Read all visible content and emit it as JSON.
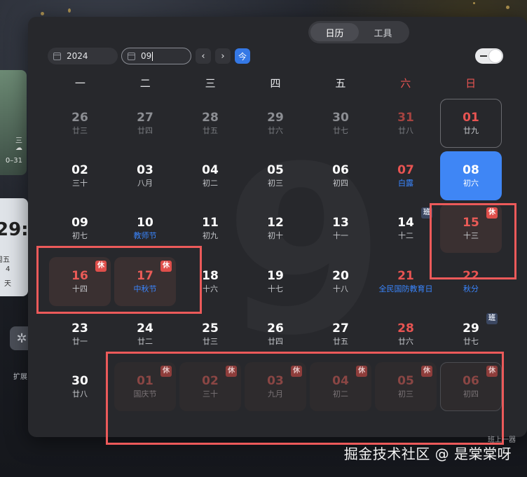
{
  "tabs": [
    {
      "label": "日历",
      "active": true
    },
    {
      "label": "工具",
      "active": false
    }
  ],
  "controls": {
    "year_value": "2024",
    "month_value": "09",
    "prev_icon": "‹",
    "next_icon": "›",
    "today_label": "今",
    "toggle_state": "on"
  },
  "weekdays": [
    "一",
    "二",
    "三",
    "四",
    "五",
    "六",
    "日"
  ],
  "days": [
    {
      "day": "26",
      "lunar": "廿三",
      "other": true
    },
    {
      "day": "27",
      "lunar": "廿四",
      "other": true
    },
    {
      "day": "28",
      "lunar": "廿五",
      "other": true
    },
    {
      "day": "29",
      "lunar": "廿六",
      "other": true
    },
    {
      "day": "30",
      "lunar": "廿七",
      "other": true
    },
    {
      "day": "31",
      "lunar": "廿八",
      "other": true,
      "weekend": true
    },
    {
      "day": "01",
      "lunar": "廿九",
      "weekend": true,
      "outlined": true
    },
    {
      "day": "02",
      "lunar": "三十"
    },
    {
      "day": "03",
      "lunar": "八月"
    },
    {
      "day": "04",
      "lunar": "初二"
    },
    {
      "day": "05",
      "lunar": "初三"
    },
    {
      "day": "06",
      "lunar": "初四"
    },
    {
      "day": "07",
      "lunar": "白露",
      "weekend": true,
      "festival": true
    },
    {
      "day": "08",
      "lunar": "初六",
      "selected": true
    },
    {
      "day": "09",
      "lunar": "初七"
    },
    {
      "day": "10",
      "lunar": "教师节",
      "festival": true
    },
    {
      "day": "11",
      "lunar": "初九"
    },
    {
      "day": "12",
      "lunar": "初十"
    },
    {
      "day": "13",
      "lunar": "十一"
    },
    {
      "day": "14",
      "lunar": "十二",
      "badge": "班",
      "badge_type": "work"
    },
    {
      "day": "15",
      "lunar": "十三",
      "holiday": true,
      "badge": "休",
      "badge_type": "rest"
    },
    {
      "day": "16",
      "lunar": "十四",
      "holiday": true,
      "badge": "休",
      "badge_type": "rest"
    },
    {
      "day": "17",
      "lunar": "中秋节",
      "holiday": true,
      "festival": true,
      "badge": "休",
      "badge_type": "rest"
    },
    {
      "day": "18",
      "lunar": "十六"
    },
    {
      "day": "19",
      "lunar": "十七"
    },
    {
      "day": "20",
      "lunar": "十八"
    },
    {
      "day": "21",
      "lunar": "全民国防教育日",
      "weekend": true,
      "festival": true
    },
    {
      "day": "22",
      "lunar": "秋分",
      "weekend": true,
      "festival": true
    },
    {
      "day": "23",
      "lunar": "廿一"
    },
    {
      "day": "24",
      "lunar": "廿二"
    },
    {
      "day": "25",
      "lunar": "廿三"
    },
    {
      "day": "26",
      "lunar": "廿四"
    },
    {
      "day": "27",
      "lunar": "廿五"
    },
    {
      "day": "28",
      "lunar": "廿六",
      "weekend": true
    },
    {
      "day": "29",
      "lunar": "廿七",
      "badge": "班",
      "badge_type": "work"
    },
    {
      "day": "30",
      "lunar": "廿八"
    },
    {
      "day": "01",
      "lunar": "国庆节",
      "other": true,
      "holiday": true,
      "festival": true,
      "badge": "休",
      "badge_type": "rest"
    },
    {
      "day": "02",
      "lunar": "三十",
      "other": true,
      "holiday": true,
      "badge": "休",
      "badge_type": "rest"
    },
    {
      "day": "03",
      "lunar": "九月",
      "other": true,
      "holiday": true,
      "badge": "休",
      "badge_type": "rest"
    },
    {
      "day": "04",
      "lunar": "初二",
      "other": true,
      "holiday": true,
      "badge": "休",
      "badge_type": "rest"
    },
    {
      "day": "05",
      "lunar": "初三",
      "other": true,
      "holiday": true,
      "badge": "休",
      "badge_type": "rest"
    },
    {
      "day": "06",
      "lunar": "初四",
      "other": true,
      "holiday": true,
      "outlined": true,
      "badge": "休",
      "badge_type": "rest"
    }
  ],
  "left_widgets": {
    "weather_line1": "三",
    "weather_line2": "0–31",
    "clock_time": "29:",
    "clock_weekday": "周五",
    "clock_count": "4",
    "clock_unit": "天",
    "extension_label": "扩展"
  },
  "watermark": "9",
  "corner_text": "班上一器",
  "credit": "掘金技术社区 @ 是棠棠呀",
  "colors": {
    "accent": "#3f86f5",
    "weekend": "#e85452",
    "festival": "#3a86ff",
    "annotation": "#ec5a5a",
    "panel": "#27282c"
  }
}
